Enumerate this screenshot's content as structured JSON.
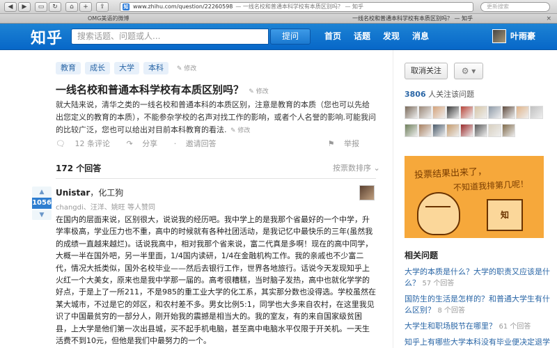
{
  "browser": {
    "url": "www.zhihu.com/question/22260598",
    "page_title": "— 一线名校和普通本科学校有本质区别吗？ — 知乎",
    "favicon_letter": "知",
    "search_placeholder": "更新搜索",
    "tabs": [
      {
        "label": "OMG美语的微博"
      },
      {
        "label": "一线名校和普通本科学校有本质区别吗？ — 知乎"
      }
    ]
  },
  "header": {
    "logo": "知乎",
    "search_placeholder": "搜索话题、问题或人...",
    "ask_label": "提问",
    "nav": [
      "首页",
      "话题",
      "发现",
      "消息"
    ],
    "username": "叶雨豪"
  },
  "question": {
    "tags": [
      "教育",
      "成长",
      "大学",
      "本科"
    ],
    "edit_label": "修改",
    "title": "一线名校和普通本科学校有本质区别吗？",
    "description": "就大陆来说，清华之类的一线名校和普通本科的本质区别，注意是教育的本质（您也可以先给出您定义的教育的本质），不能参杂学校的名声对找工作的影响，或者个人名誉的影响.可能我问的比较广泛，您也可以给出对目前本科教育的看法.",
    "comments": "12 条评论",
    "share": "分享",
    "invite": "邀请回答",
    "report": "举报"
  },
  "answers": {
    "count_label": "172 个回答",
    "sort_label": "按票数排序",
    "top": {
      "votes": "1056",
      "author": "Unistar",
      "bio": "，化工狗",
      "voters": "changdi、汪洋、姚旺 等人赞同",
      "body": "在国内的层面来说，区别很大，说说我的经历吧。我中学上的是我那个省最好的一个中学，升学率极高，学业压力也不重，高中的时候就有各种社团活动，是我记忆中最快乐的三年(虽然我的成绩一直越来越烂)。话说我高中，相对我那个省来说，富二代真是多啊！现在的高中同学，大概一半在国外吧，另一半里面，1/4国内读研，1/4在金融机构工作。我的亲戚也不少富二代，情况大抵类似，国外名校毕业——然后去银行工作，世界各地旅行。话说今天发现知乎上火红一个大美女，原来也是我中学那一届的。高考很糟糕，当时脑子发热，高中也就化学学的好点，于是上了一所211，不是985的重工业大学的化工系，其实那分数也没得选。学校虽然在某大城市，不过是它的郊区，和农村差不多。男女比例5:1，同学也大多来自农村，在这里我见识了中国最贫穷的一部分人，刚开始我的震撼是相当大的。我的室友，有的来自国家级贫困县，上大学是他们第一次出县城，买不起手机电脑，甚至高中电脑水平仅限于开关机。一天生活费不到10元，但他是我们中最努力的一个。"
    }
  },
  "sidebar": {
    "unfollow_label": "取消关注",
    "gear_label": "⚙ ▾",
    "followers_count": "3806",
    "followers_suffix": " 人关注该问题",
    "ad_line1": "投票结果出来了，",
    "ad_line2": "不知道我排第几呢！",
    "ad_board": "知",
    "related_title": "相关问题",
    "related": [
      {
        "q": "大学的本质是什么？大学的职责又应该是什么？",
        "meta": "57 个回答"
      },
      {
        "q": "国防生的生活是怎样的？和普通大学生有什么区别？",
        "meta": "8 个回答"
      },
      {
        "q": "大学生和职场脱节在哪里？",
        "meta": "61 个回答"
      },
      {
        "q": "知乎上有哪些大学本科没有毕业便决定退学的",
        "meta": ""
      }
    ]
  },
  "colors": {
    "header_blue": "#0767c8",
    "link_blue": "#2a66a6",
    "vote_blue": "#2e7ed0",
    "ad_orange": "#f6a83b"
  }
}
